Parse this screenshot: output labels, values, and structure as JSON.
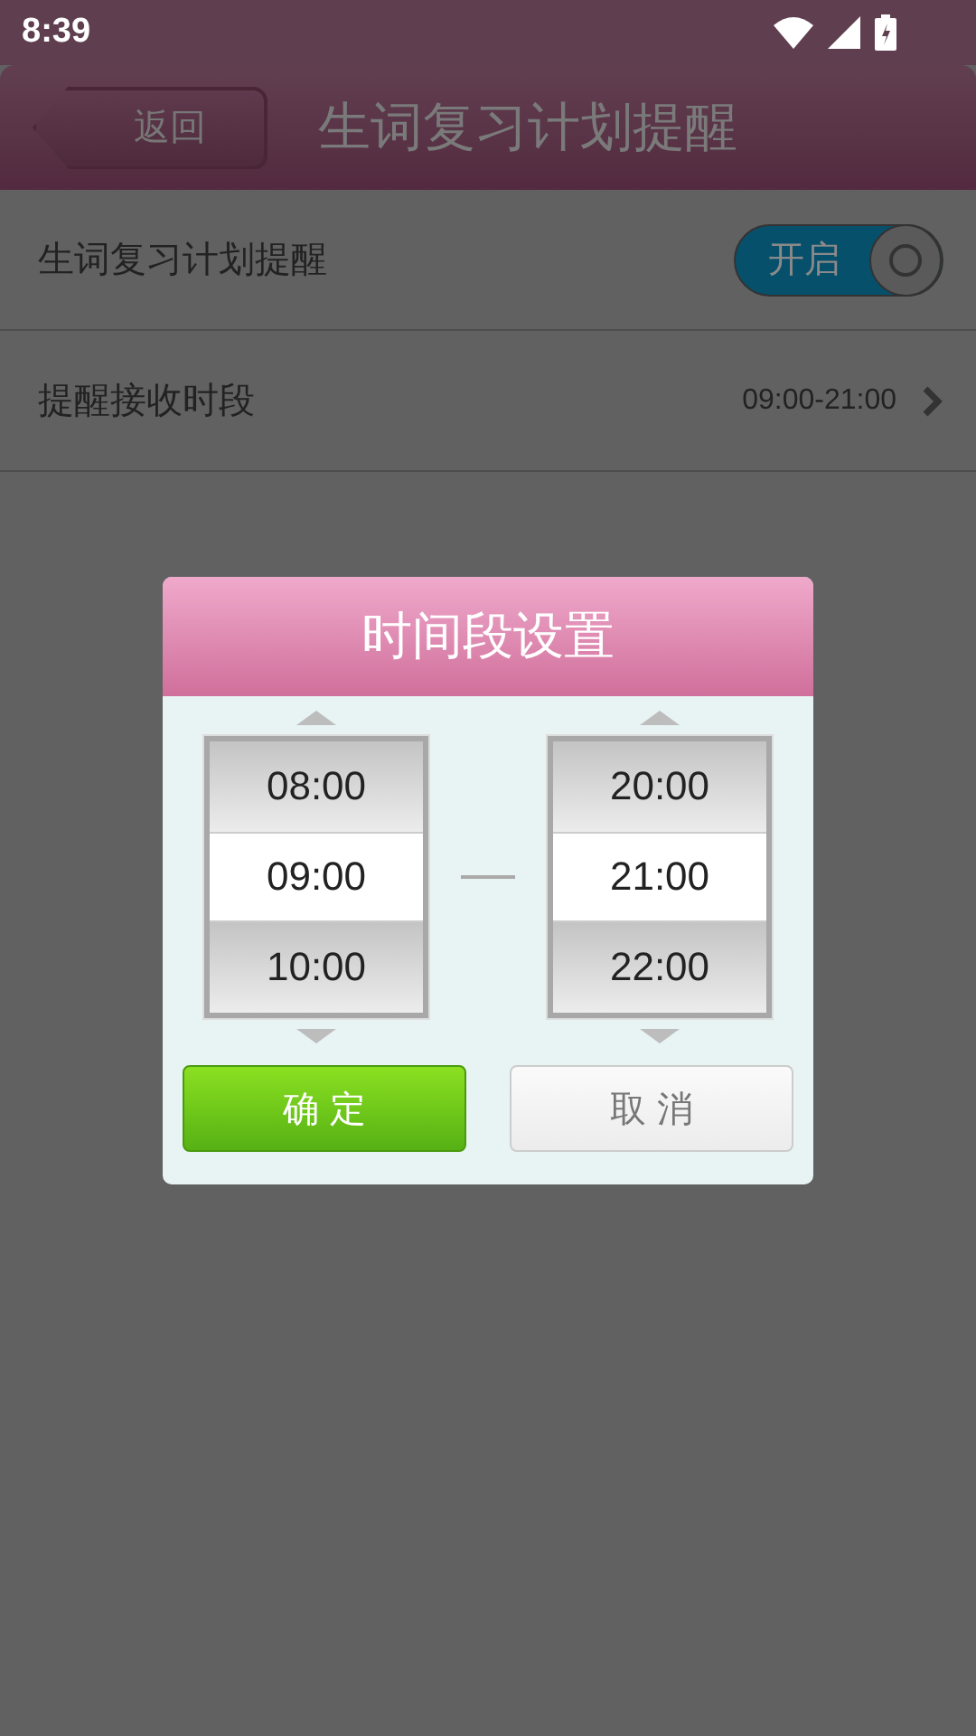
{
  "status_bar": {
    "time": "8:39"
  },
  "header": {
    "back": "返回",
    "title": "生词复习计划提醒"
  },
  "settings": [
    {
      "kind": "toggle",
      "label": "生词复习计划提醒",
      "toggle": {
        "label": "开启",
        "on": true
      }
    },
    {
      "kind": "value",
      "label": "提醒接收时段",
      "value": "09:00-21:00"
    }
  ],
  "dialog": {
    "title": "时间段设置",
    "pickers": [
      [
        {
          "label": "08:00",
          "selected": false
        },
        {
          "label": "09:00",
          "selected": true
        },
        {
          "label": "10:00",
          "selected": false
        }
      ],
      [
        {
          "label": "20:00",
          "selected": false
        },
        {
          "label": "21:00",
          "selected": true
        },
        {
          "label": "22:00",
          "selected": false
        }
      ]
    ],
    "confirm": "确 定",
    "cancel": "取 消"
  }
}
